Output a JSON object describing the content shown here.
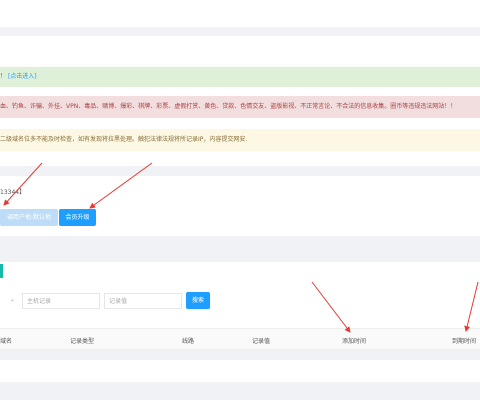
{
  "notices": {
    "green": {
      "text": "！",
      "link": "[点击进入]"
    },
    "red": {
      "text": "血、钓鱼、诈骗、外挂、VPN、毒品、赌博、爆彩、棋牌、彩票、虚假打赏、黄色、贷款、色情交友、盗版影视、不正常言论、不合法的信息收集。圈币等违规违法网站！！"
    },
    "yellow": {
      "text": "二级域名位多不能及时检查，如有发现将拉黑处理。触犯法律法规将所记录IP，内容提交网安."
    }
  },
  "account": {
    "count_text": "13344】",
    "buttons": {
      "default_label": "调用户他:默认他",
      "upgrade_label": "会员升级"
    }
  },
  "search": {
    "chevron": "⌄",
    "host_placeholder": "主机记录",
    "value_placeholder": "记录值",
    "search_label": "搜索"
  },
  "table": {
    "headers": [
      "域名",
      "记录类型",
      "线路",
      "记录值",
      "添加时间",
      "到期时间"
    ]
  },
  "colors": {
    "accent": "#1e9fff",
    "teal": "#16baaa",
    "arrow": "#e53935"
  }
}
